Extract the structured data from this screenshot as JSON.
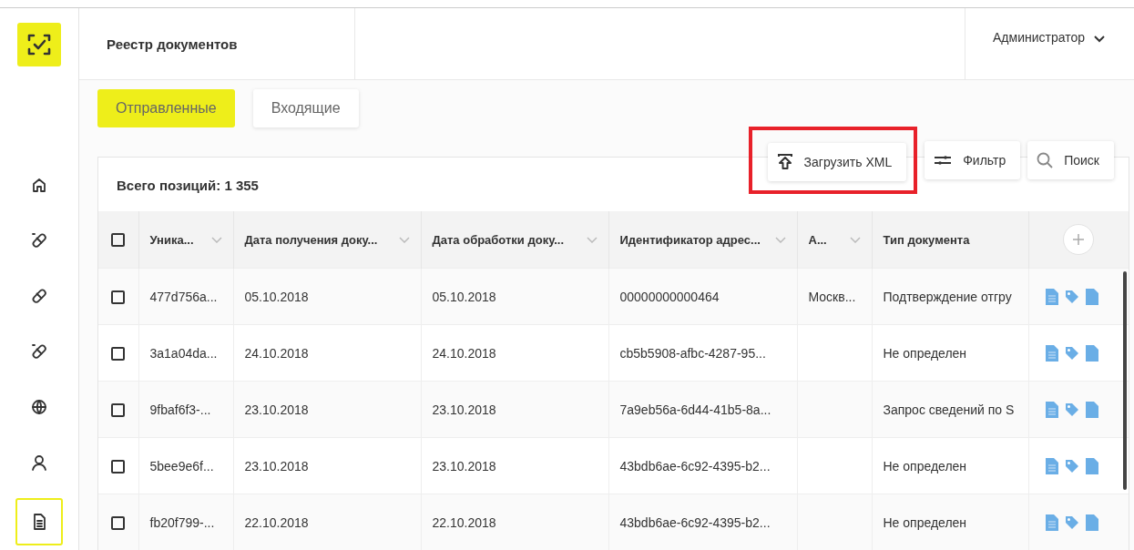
{
  "sidebar": {
    "items": [
      {
        "selected": false
      },
      {
        "selected": false
      },
      {
        "selected": false
      },
      {
        "selected": false
      },
      {
        "selected": false
      },
      {
        "selected": false
      },
      {
        "selected": true
      }
    ]
  },
  "header": {
    "title": "Реестр документов",
    "user": "Администратор"
  },
  "tabs": [
    {
      "label": "Отправленные",
      "selected": true
    },
    {
      "label": "Входящие",
      "selected": false
    }
  ],
  "toolbar": {
    "upload": "Загрузить XML",
    "filter": "Фильтр",
    "search": "Поиск"
  },
  "total": "Всего позиций: 1 355",
  "table": {
    "select_all_checked": false,
    "columns": [
      {
        "label": "Уника...",
        "sortable": true
      },
      {
        "label": "Дата получения доку...",
        "sortable": true
      },
      {
        "label": "Дата обработки доку...",
        "sortable": true
      },
      {
        "label": "Идентификатор адрес...",
        "sortable": true
      },
      {
        "label": "А...",
        "sortable": true
      },
      {
        "label": "Тип документа",
        "sortable": false
      }
    ],
    "rows": [
      {
        "checked": false,
        "cells": [
          "477d756a...",
          "05.10.2018",
          "05.10.2018",
          "00000000000464",
          "Москв...",
          "Подтверждение отгру"
        ]
      },
      {
        "checked": false,
        "cells": [
          "3a1a04da...",
          "24.10.2018",
          "24.10.2018",
          "cb5b5908-afbc-4287-95...",
          "",
          "Не определен"
        ]
      },
      {
        "checked": false,
        "cells": [
          "9fbaf6f3-...",
          "23.10.2018",
          "23.10.2018",
          "7a9eb56a-6d44-41b5-8a...",
          "",
          "Запрос сведений по S"
        ]
      },
      {
        "checked": false,
        "cells": [
          "5bee9e6f...",
          "23.10.2018",
          "23.10.2018",
          "43bdb6ae-6c92-4395-b2...",
          "",
          "Не определен"
        ]
      },
      {
        "checked": false,
        "cells": [
          "fb20f799-...",
          "22.10.2018",
          "22.10.2018",
          "43bdb6ae-6c92-4395-b2...",
          "",
          "Не определен"
        ]
      }
    ]
  }
}
